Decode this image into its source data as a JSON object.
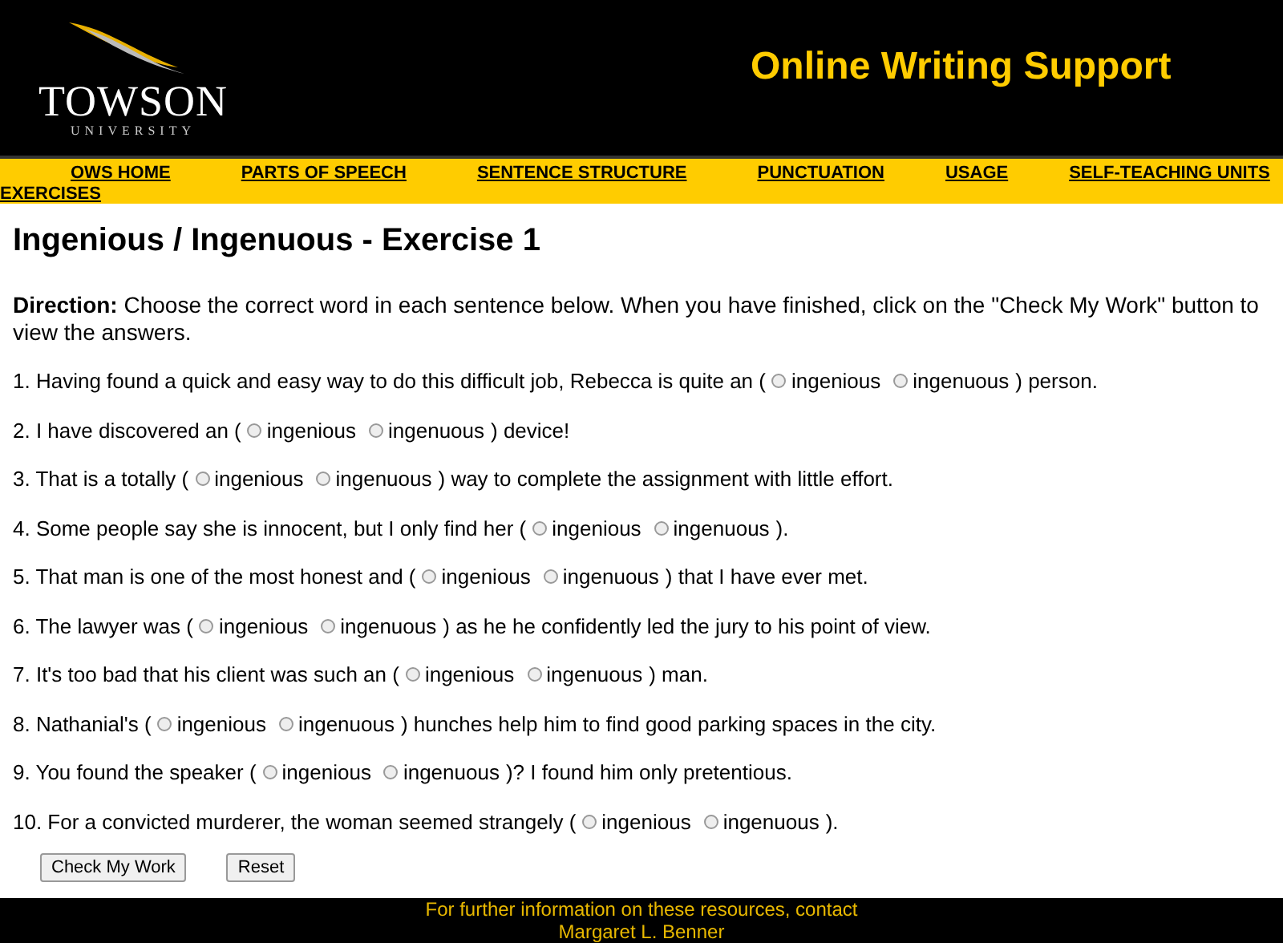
{
  "header": {
    "logo_name": "TOWSON",
    "logo_sub": "UNIVERSITY",
    "title": "Online Writing Support"
  },
  "nav": [
    "OWS HOME",
    "PARTS OF SPEECH",
    "SENTENCE STRUCTURE",
    "PUNCTUATION",
    "USAGE",
    "SELF-TEACHING UNITS",
    "EXERCISES"
  ],
  "page_title": "Ingenious / Ingenuous - Exercise 1",
  "direction": {
    "label": "Direction:",
    "text": "Choose the correct word in each sentence below. When you have finished, click on the \"Check My Work\" button to view the answers."
  },
  "questions": [
    {
      "before": "1. Having found a quick and easy way to do this difficult job, Rebecca is quite an (",
      "options": [
        {
          "label": "ingenious",
          "selected": false
        },
        {
          "label": "ingenuous",
          "selected": false
        }
      ],
      "after": ") person."
    },
    {
      "before": "2. I have discovered an (",
      "options": [
        {
          "label": "ingenious",
          "selected": false
        },
        {
          "label": "ingenuous",
          "selected": false
        }
      ],
      "after": ") device!"
    },
    {
      "before": "3. That is a totally (",
      "options": [
        {
          "label": "ingenious",
          "selected": false
        },
        {
          "label": "ingenuous",
          "selected": false
        }
      ],
      "after": ") way to complete the assignment with little effort."
    },
    {
      "before": "4. Some people say she is innocent, but I only find her (",
      "options": [
        {
          "label": "ingenious",
          "selected": false
        },
        {
          "label": "ingenuous",
          "selected": false
        }
      ],
      "after": ")."
    },
    {
      "before": "5. That man is one of the most honest and (",
      "options": [
        {
          "label": "ingenious",
          "selected": false
        },
        {
          "label": "ingenuous",
          "selected": false
        }
      ],
      "after": ") that I have ever met."
    },
    {
      "before": "6. The lawyer was (",
      "options": [
        {
          "label": "ingenious",
          "selected": false
        },
        {
          "label": "ingenuous",
          "selected": false
        }
      ],
      "after": ") as he he confidently led the jury to his point of view."
    },
    {
      "before": "7. It's too bad that his client was such an (",
      "options": [
        {
          "label": "ingenious",
          "selected": false
        },
        {
          "label": "ingenuous",
          "selected": false
        }
      ],
      "after": ") man."
    },
    {
      "before": "8. Nathanial's (",
      "options": [
        {
          "label": "ingenious",
          "selected": false
        },
        {
          "label": "ingenuous",
          "selected": false
        }
      ],
      "after": ") hunches help him to find good parking spaces in the city."
    },
    {
      "before": "9. You found the speaker (",
      "options": [
        {
          "label": "ingenious",
          "selected": false
        },
        {
          "label": "ingenuous",
          "selected": false
        }
      ],
      "after": ")? I found him only pretentious."
    },
    {
      "before": "10. For a convicted murderer, the woman seemed strangely (",
      "options": [
        {
          "label": "ingenious",
          "selected": false
        },
        {
          "label": "ingenuous",
          "selected": false
        }
      ],
      "after": ")."
    }
  ],
  "buttons": [
    "Check My Work",
    "Reset"
  ],
  "footer": [
    "For further information on these resources, contact",
    "Margaret L. Benner"
  ]
}
